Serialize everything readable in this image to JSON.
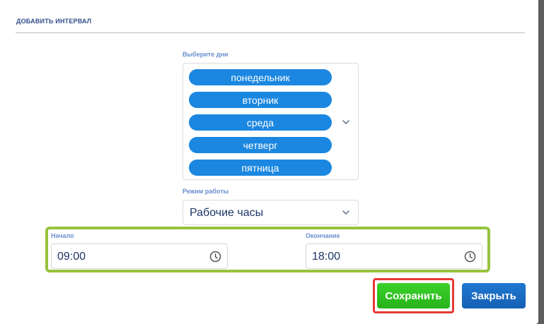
{
  "dialog": {
    "title": "ДОБАВИТЬ ИНТЕРВАЛ"
  },
  "days": {
    "label": "Выберите дни",
    "selected": [
      "понедельник",
      "вторник",
      "среда",
      "четверг",
      "пятница"
    ],
    "chip_color": "#1b87e0",
    "icon": "chevron-down-icon"
  },
  "mode": {
    "label": "Режим работы",
    "value": "Рабочие часы",
    "icon": "chevron-down-icon"
  },
  "time": {
    "start_label": "Начало",
    "start_value": "09:00",
    "end_label": "Окончание",
    "end_value": "18:00",
    "icon": "clock-icon",
    "highlight_color": "#97c33d"
  },
  "actions": {
    "save_label": "Сохранить",
    "close_label": "Закрыть",
    "save_color": "#2ec320",
    "close_color": "#1b6cc4",
    "save_highlight_color": "#e53935"
  }
}
